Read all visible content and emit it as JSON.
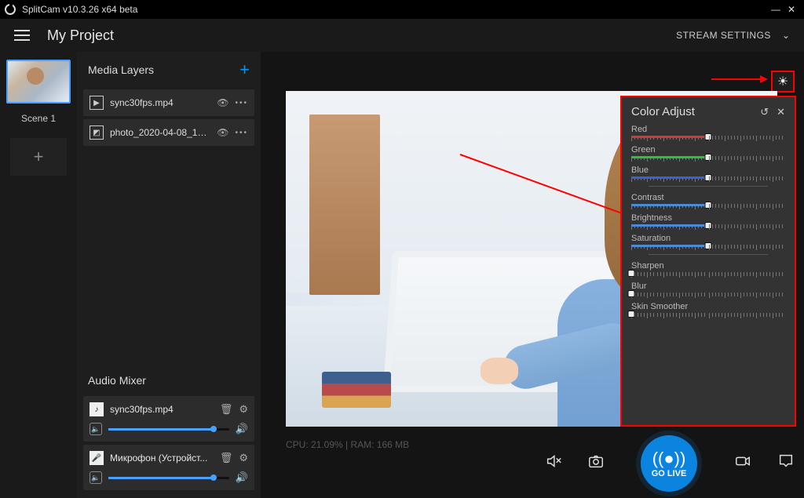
{
  "titlebar": {
    "title": "SplitCam v10.3.26 x64 beta"
  },
  "header": {
    "project_name": "My Project",
    "stream_settings": "STREAM SETTINGS"
  },
  "scenes": {
    "items": [
      {
        "label": "Scene 1"
      }
    ]
  },
  "media_layers": {
    "title": "Media Layers",
    "items": [
      {
        "icon": "▶",
        "name": "sync30fps.mp4"
      },
      {
        "icon": "◩",
        "name": "photo_2020-04-08_12...."
      }
    ]
  },
  "audio_mixer": {
    "title": "Audio Mixer",
    "items": [
      {
        "icon": "♪",
        "name": "sync30fps.mp4",
        "level_pct": 88
      },
      {
        "icon": "🎤",
        "name": "Микрофон (Устройст...",
        "level_pct": 88
      }
    ]
  },
  "status": {
    "text": "CPU: 21.09% | RAM: 166 MB"
  },
  "color_adjust": {
    "title": "Color Adjust",
    "controls": [
      {
        "key": "red",
        "label": "Red",
        "color": "#d23a3a",
        "value": 50
      },
      {
        "key": "green",
        "label": "Green",
        "color": "#2fbf3a",
        "value": 50
      },
      {
        "key": "blue",
        "label": "Blue",
        "color": "#3a62d2",
        "value": 50
      },
      {
        "sep": true
      },
      {
        "key": "contrast",
        "label": "Contrast",
        "color": "#4a8ad6",
        "value": 50
      },
      {
        "key": "brightness",
        "label": "Brightness",
        "color": "#4a8ad6",
        "value": 50
      },
      {
        "key": "saturation",
        "label": "Saturation",
        "color": "#4a8ad6",
        "value": 50
      },
      {
        "sep": true
      },
      {
        "key": "sharpen",
        "label": "Sharpen",
        "color": "#4a8ad6",
        "value": 0
      },
      {
        "key": "blur",
        "label": "Blur",
        "color": "#4a8ad6",
        "value": 0
      },
      {
        "key": "skin",
        "label": "Skin Smoother",
        "color": "#4a8ad6",
        "value": 0
      }
    ]
  },
  "bottom": {
    "golive": "GO LIVE"
  }
}
